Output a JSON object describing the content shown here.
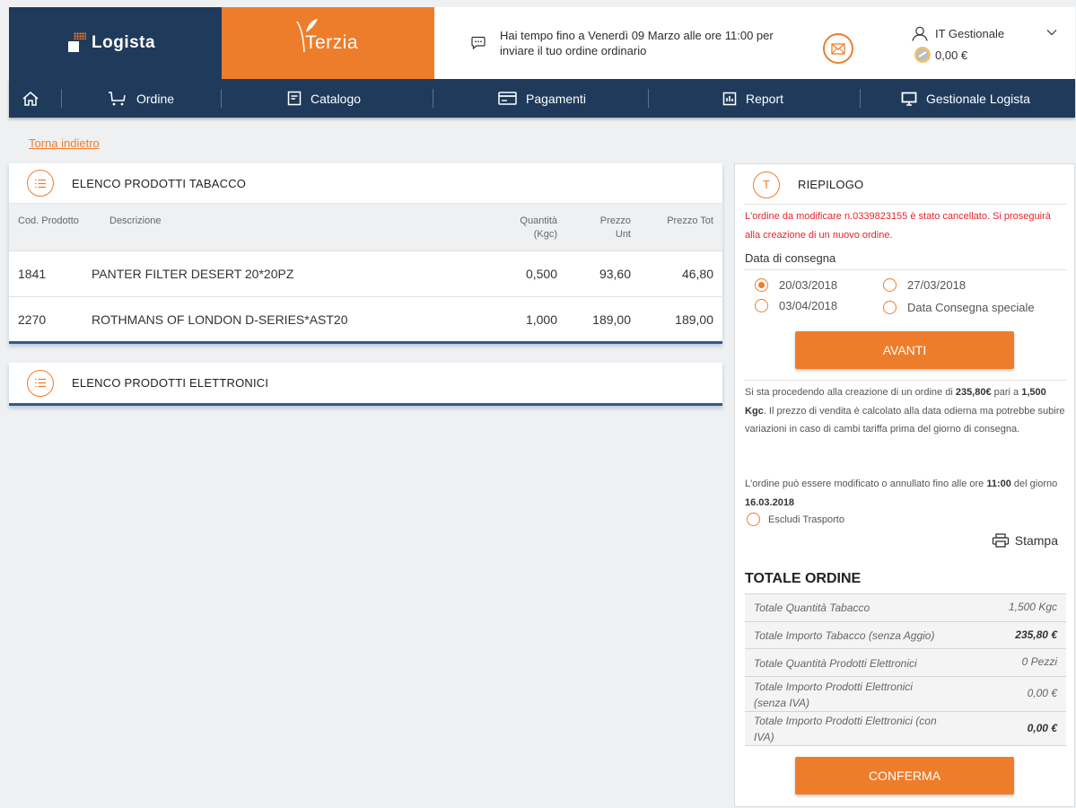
{
  "header": {
    "brand_logista": "Logista",
    "brand_terzia": "Terzia",
    "deadline_message": "Hai tempo fino a Venerdì 09 Marzo alle ore 11:00 per inviare il tuo ordine ordinario",
    "user_name": "IT Gestionale",
    "wallet_amount": "0,00 €"
  },
  "nav": {
    "home_icon": "home-icon",
    "items": [
      {
        "label": "Ordine",
        "icon": "cart-icon"
      },
      {
        "label": "Catalogo",
        "icon": "catalog-icon"
      },
      {
        "label": "Pagamenti",
        "icon": "card-icon"
      },
      {
        "label": "Report",
        "icon": "report-icon"
      },
      {
        "label": "Gestionale Logista",
        "icon": "monitor-icon"
      }
    ]
  },
  "back_link": "Torna indietro",
  "tobacco": {
    "title": "ELENCO PRODOTTI TABACCO",
    "columns": {
      "code": "Cod. Prodotto",
      "desc": "Descrizione",
      "qty": "Quantità\n(Kgc)",
      "unit": "Prezzo\nUnt",
      "total": "Prezzo Tot"
    },
    "rows": [
      {
        "code": "1841",
        "desc": "PANTER FILTER DESERT 20*20PZ",
        "qty": "0,500",
        "unit": "93,60",
        "total": "46,80"
      },
      {
        "code": "2270",
        "desc": "ROTHMANS OF LONDON D-SERIES*AST20",
        "qty": "1,000",
        "unit": "189,00",
        "total": "189,00"
      }
    ]
  },
  "electronics": {
    "title": "ELENCO PRODOTTI ELETTRONICI"
  },
  "summary": {
    "icon_letter": "T",
    "title": "RIEPILOGO",
    "warning": "L'ordine da modificare n.0339823155 è stato cancellato. Si proseguirà alla creazione di un nuovo ordine.",
    "delivery_label": "Data di consegna",
    "delivery_options": [
      {
        "label": "20/03/2018",
        "selected": true
      },
      {
        "label": "27/03/2018",
        "selected": false
      },
      {
        "label": "03/04/2018",
        "selected": false
      },
      {
        "label": "Data Consegna speciale",
        "selected": false
      }
    ],
    "next_button": "AVANTI",
    "info_1_a": "Si sta procedendo alla creazione di un ordine di ",
    "info_1_amount": "235,80€",
    "info_1_b": " pari a ",
    "info_1_kgc": "1,500 Kgc",
    "info_1_c": ". Il prezzo di vendita è calcolato alla data odierna ma potrebbe subire variazioni in caso di cambi tariffa prima del giorno di consegna.",
    "info_2_a": "L'ordine può essere modificato o annullato fino alle ore ",
    "info_2_time": "11:00",
    "info_2_b": " del giorno ",
    "info_2_date": "16.03.2018",
    "exclude_transport": "Escludi Trasporto",
    "print": "Stampa",
    "total_title": "TOTALE ORDINE",
    "totals": [
      {
        "label": "Totale Quantità Tabacco",
        "value": "1,500 Kgc",
        "bold": false
      },
      {
        "label": "Totale Importo Tabacco (senza Aggio)",
        "value": "235,80 €",
        "bold": true
      },
      {
        "label": "Totale Quantità Prodotti Elettronici",
        "value": "0 Pezzi",
        "bold": false
      },
      {
        "label": "Totale Importo Prodotti Elettronici (senza IVA)",
        "value": "0,00 €",
        "bold": false
      },
      {
        "label": "Totale Importo Prodotti Elettronici (con IVA)",
        "value": "0,00 €",
        "bold": true
      }
    ],
    "confirm_button": "CONFERMA"
  },
  "colors": {
    "navy": "#1f3a5b",
    "orange": "#ee7d2b",
    "warning_red": "#e2262d"
  }
}
